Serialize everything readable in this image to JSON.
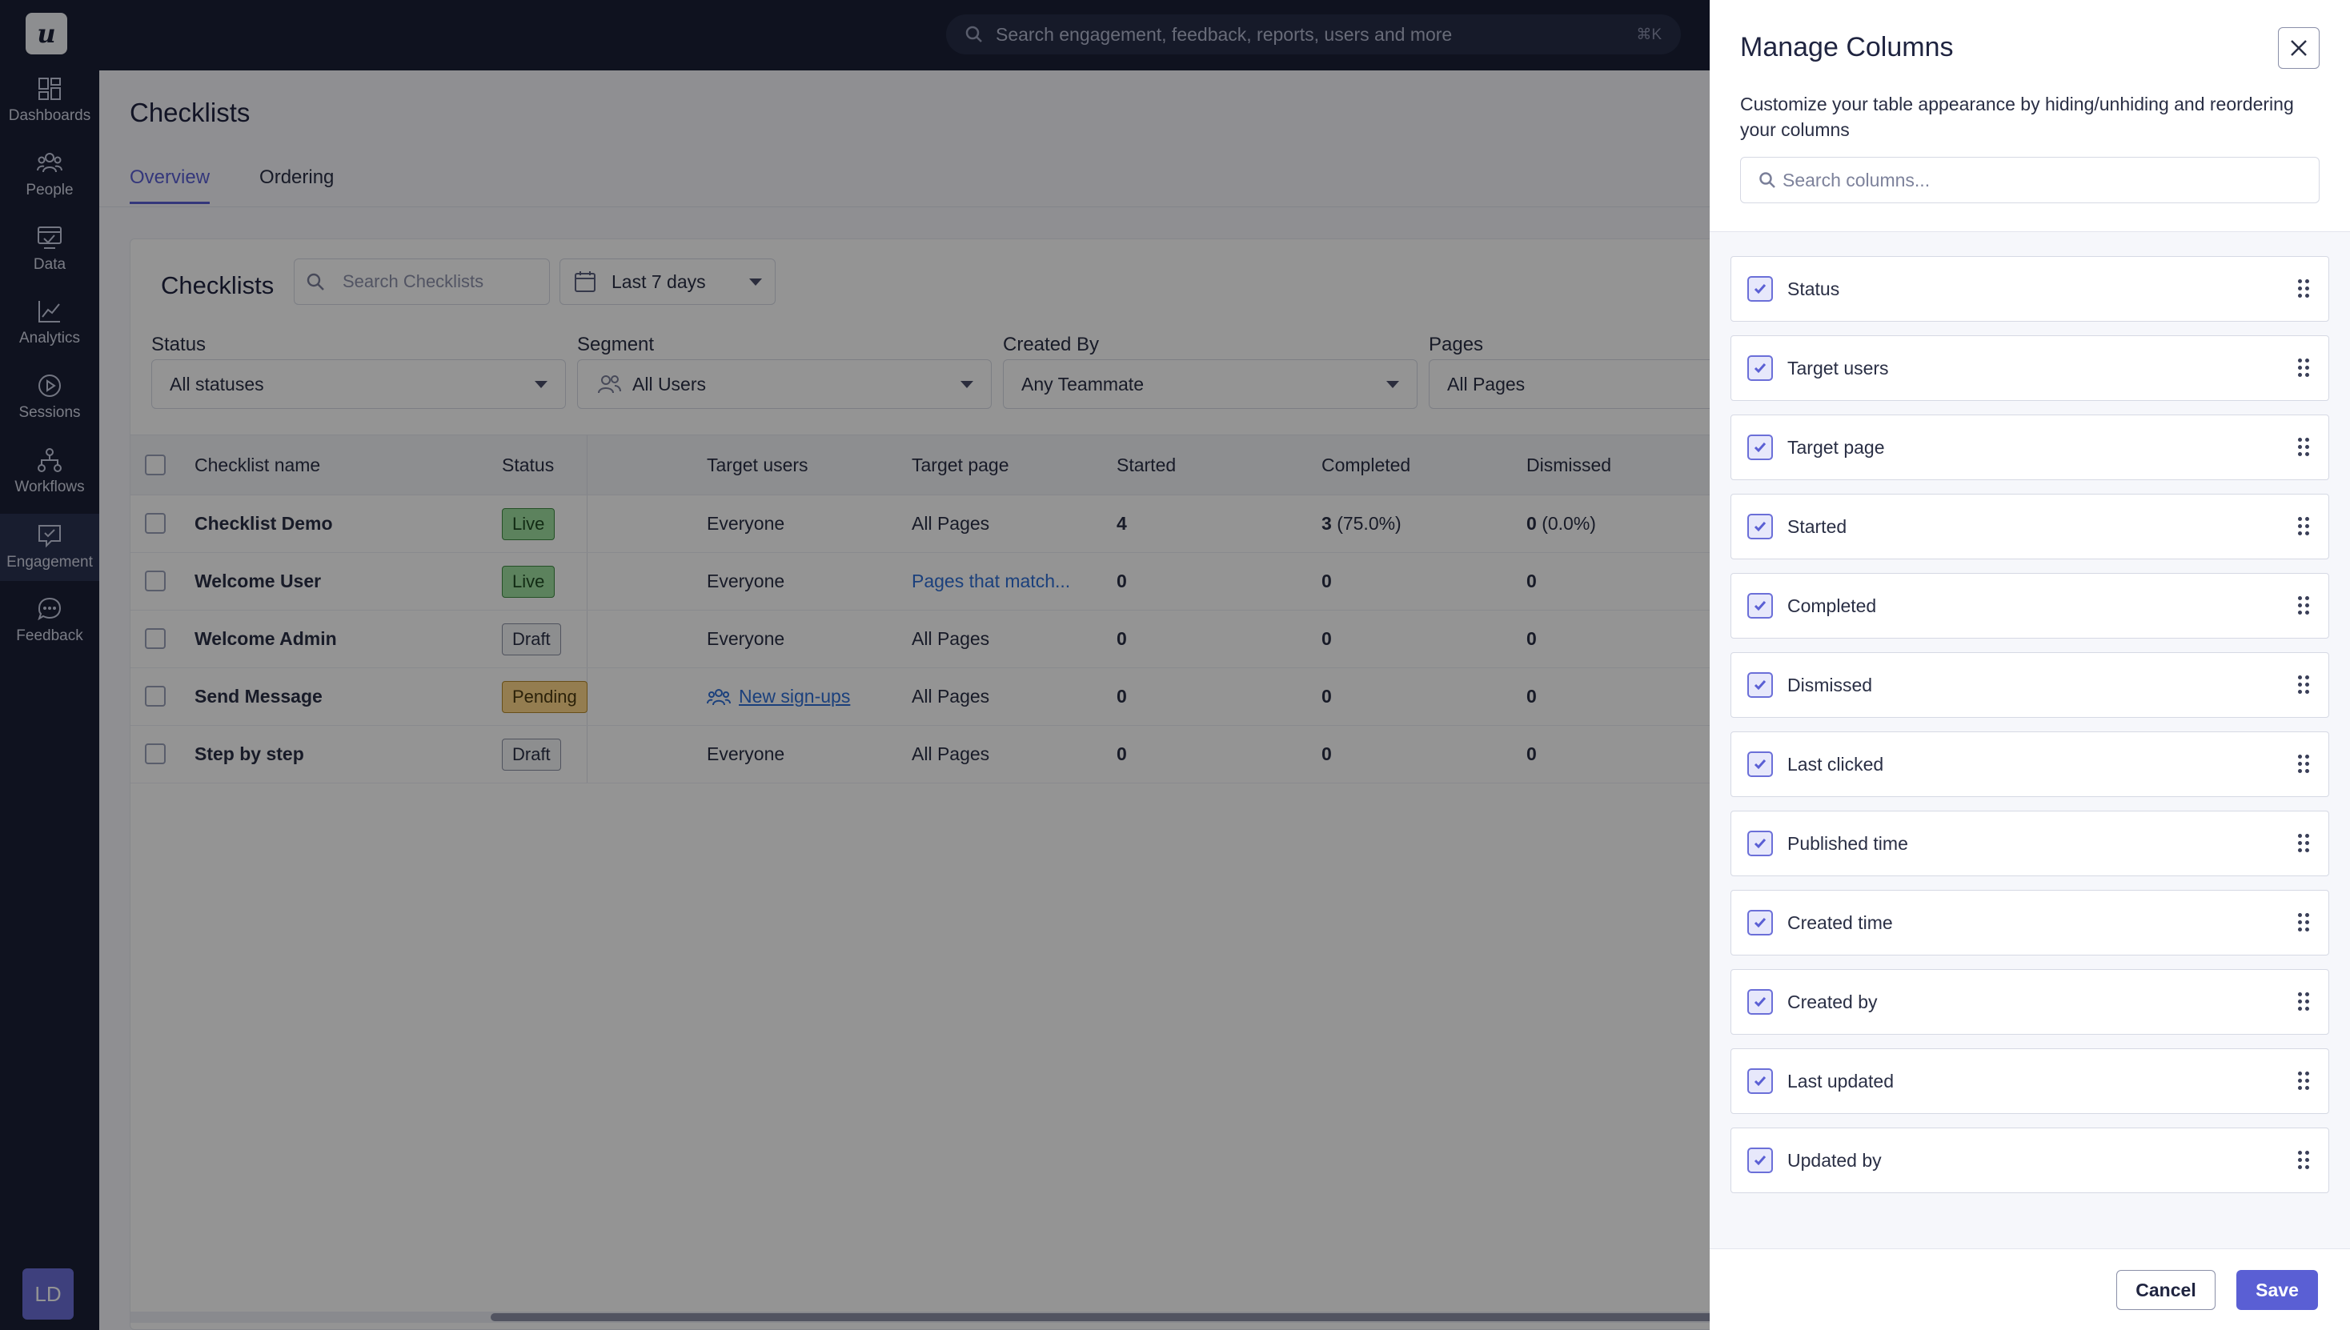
{
  "app": {
    "logo_letter": "u",
    "avatar_initials": "LD"
  },
  "sidebar": {
    "items": [
      {
        "label": "Dashboards",
        "icon": "dashboards-icon"
      },
      {
        "label": "People",
        "icon": "people-icon"
      },
      {
        "label": "Data",
        "icon": "data-icon"
      },
      {
        "label": "Analytics",
        "icon": "analytics-icon"
      },
      {
        "label": "Sessions",
        "icon": "sessions-icon"
      },
      {
        "label": "Workflows",
        "icon": "workflows-icon"
      },
      {
        "label": "Engagement",
        "icon": "engagement-icon",
        "active": true
      },
      {
        "label": "Feedback",
        "icon": "feedback-icon"
      }
    ]
  },
  "topbar": {
    "search_placeholder": "Search engagement, feedback, reports, users and more",
    "shortcut": "⌘K"
  },
  "page": {
    "title": "Checklists",
    "tabs": [
      {
        "label": "Overview",
        "active": true
      },
      {
        "label": "Ordering",
        "active": false
      }
    ]
  },
  "card": {
    "title": "Checklists",
    "search_placeholder": "Search Checklists",
    "date_range": "Last 7 days",
    "filters": [
      {
        "label": "Status",
        "value": "All statuses"
      },
      {
        "label": "Segment",
        "value": "All Users"
      },
      {
        "label": "Created By",
        "value": "Any Teammate"
      },
      {
        "label": "Pages",
        "value": "All Pages"
      }
    ]
  },
  "table": {
    "headers": [
      "Checklist name",
      "Status",
      "Target users",
      "Target page",
      "Started",
      "Completed",
      "Dismissed"
    ],
    "rows": [
      {
        "name": "Checklist Demo",
        "status": "Live",
        "target_users": "Everyone",
        "target_page": "All Pages",
        "started": "4",
        "completed": "3",
        "completed_pct": "(75.0%)",
        "dismissed": "0",
        "dismissed_pct": "(0.0%)"
      },
      {
        "name": "Welcome User",
        "status": "Live",
        "target_users": "Everyone",
        "target_page": "Pages that match...",
        "started": "0",
        "completed": "0",
        "completed_pct": "",
        "dismissed": "0",
        "dismissed_pct": ""
      },
      {
        "name": "Welcome Admin",
        "status": "Draft",
        "target_users": "Everyone",
        "target_page": "All Pages",
        "started": "0",
        "completed": "0",
        "completed_pct": "",
        "dismissed": "0",
        "dismissed_pct": ""
      },
      {
        "name": "Send Message",
        "status": "Pending",
        "target_users": "New sign-ups",
        "target_page": "All Pages",
        "started": "0",
        "completed": "0",
        "completed_pct": "",
        "dismissed": "0",
        "dismissed_pct": ""
      },
      {
        "name": "Step by step",
        "status": "Draft",
        "target_users": "Everyone",
        "target_page": "All Pages",
        "started": "0",
        "completed": "0",
        "completed_pct": "",
        "dismissed": "0",
        "dismissed_pct": ""
      }
    ]
  },
  "drawer": {
    "title": "Manage Columns",
    "description": "Customize your table appearance by hiding/unhiding and reordering your columns",
    "search_placeholder": "Search columns...",
    "columns": [
      {
        "label": "Status",
        "checked": true
      },
      {
        "label": "Target users",
        "checked": true
      },
      {
        "label": "Target page",
        "checked": true
      },
      {
        "label": "Started",
        "checked": true
      },
      {
        "label": "Completed",
        "checked": true
      },
      {
        "label": "Dismissed",
        "checked": true
      },
      {
        "label": "Last clicked",
        "checked": true
      },
      {
        "label": "Published time",
        "checked": true
      },
      {
        "label": "Created time",
        "checked": true
      },
      {
        "label": "Created by",
        "checked": true
      },
      {
        "label": "Last updated",
        "checked": true
      },
      {
        "label": "Updated by",
        "checked": true
      }
    ],
    "cancel_label": "Cancel",
    "save_label": "Save"
  },
  "colors": {
    "accent": "#5a5fd4",
    "sidebar_bg": "#1a2036",
    "live_badge": "#9fe0a1",
    "pending_badge": "#ffd88a",
    "link": "#2f6fd6"
  }
}
